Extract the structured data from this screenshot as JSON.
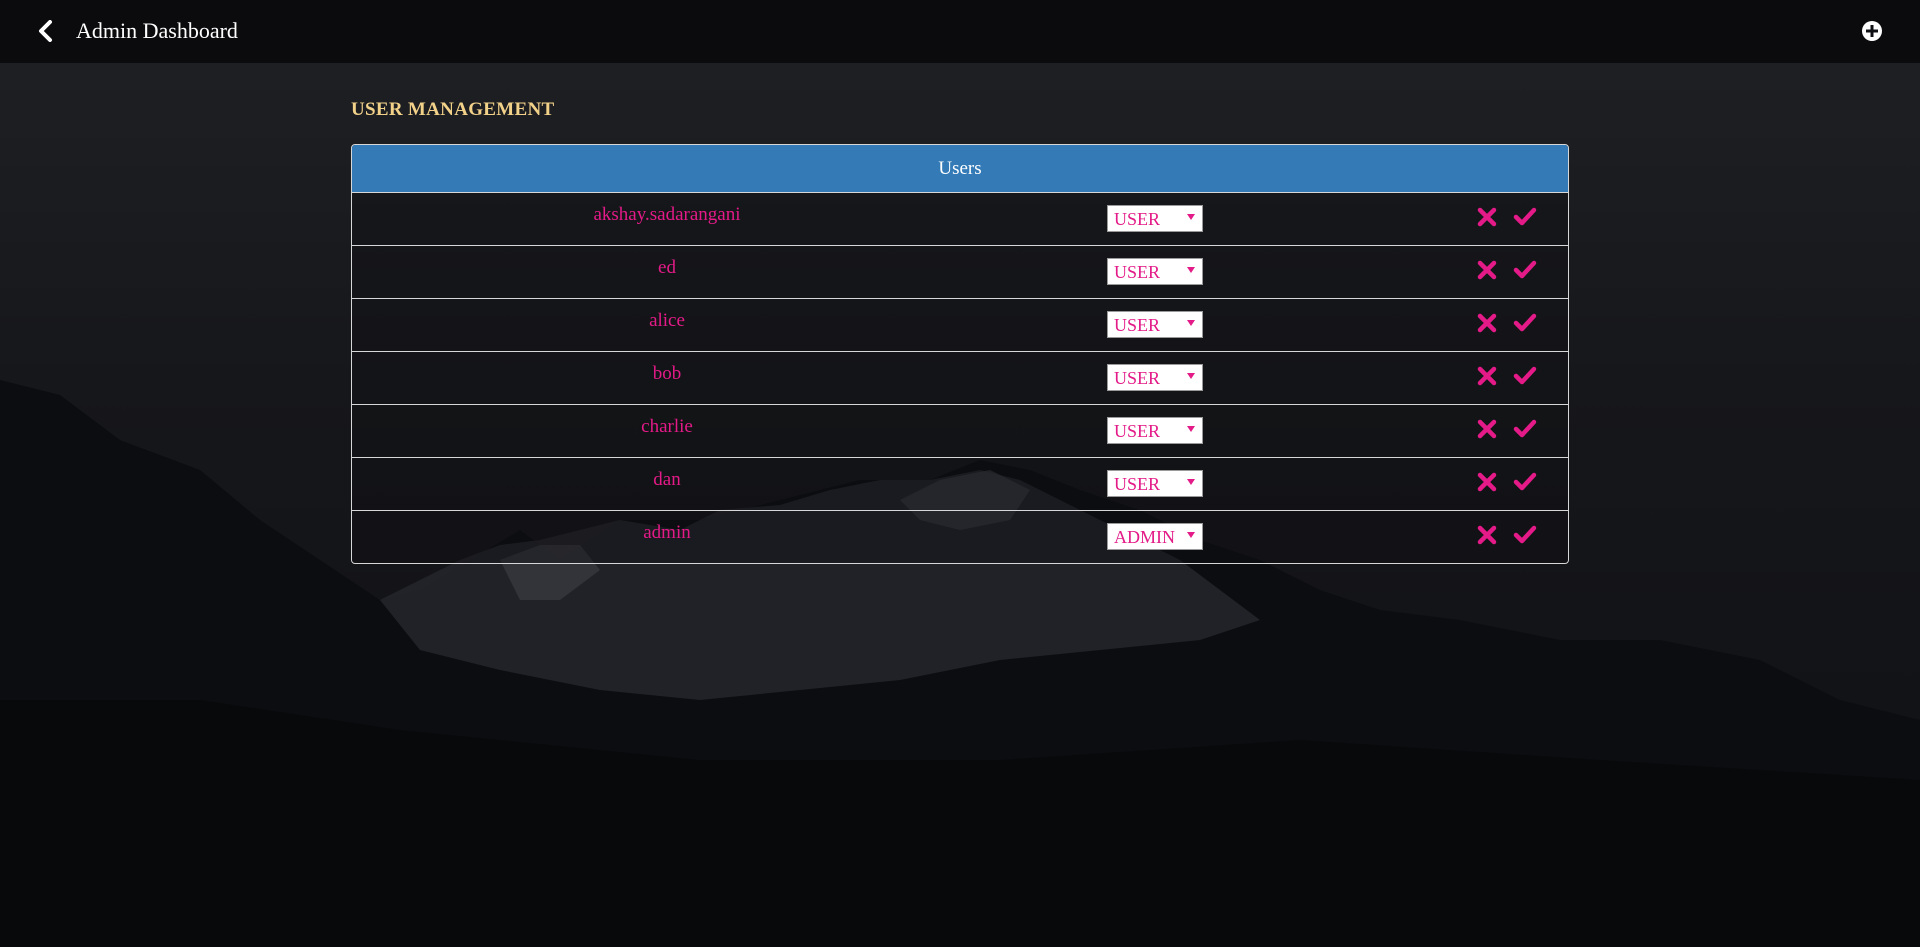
{
  "header": {
    "title": "Admin Dashboard",
    "back_icon": "chevron-left-icon",
    "add_icon": "plus-circle-icon"
  },
  "section": {
    "title": "USER MANAGEMENT"
  },
  "users_panel": {
    "heading": "Users",
    "rows": [
      {
        "username": "akshay.sadarangani",
        "role": "USER"
      },
      {
        "username": "ed",
        "role": "USER"
      },
      {
        "username": "alice",
        "role": "USER"
      },
      {
        "username": "bob",
        "role": "USER"
      },
      {
        "username": "charlie",
        "role": "USER"
      },
      {
        "username": "dan",
        "role": "USER"
      },
      {
        "username": "admin",
        "role": "ADMIN"
      }
    ]
  },
  "colors": {
    "accent_pink": "#e31a87",
    "panel_header": "#337ab7",
    "section_title": "#f2d189"
  }
}
